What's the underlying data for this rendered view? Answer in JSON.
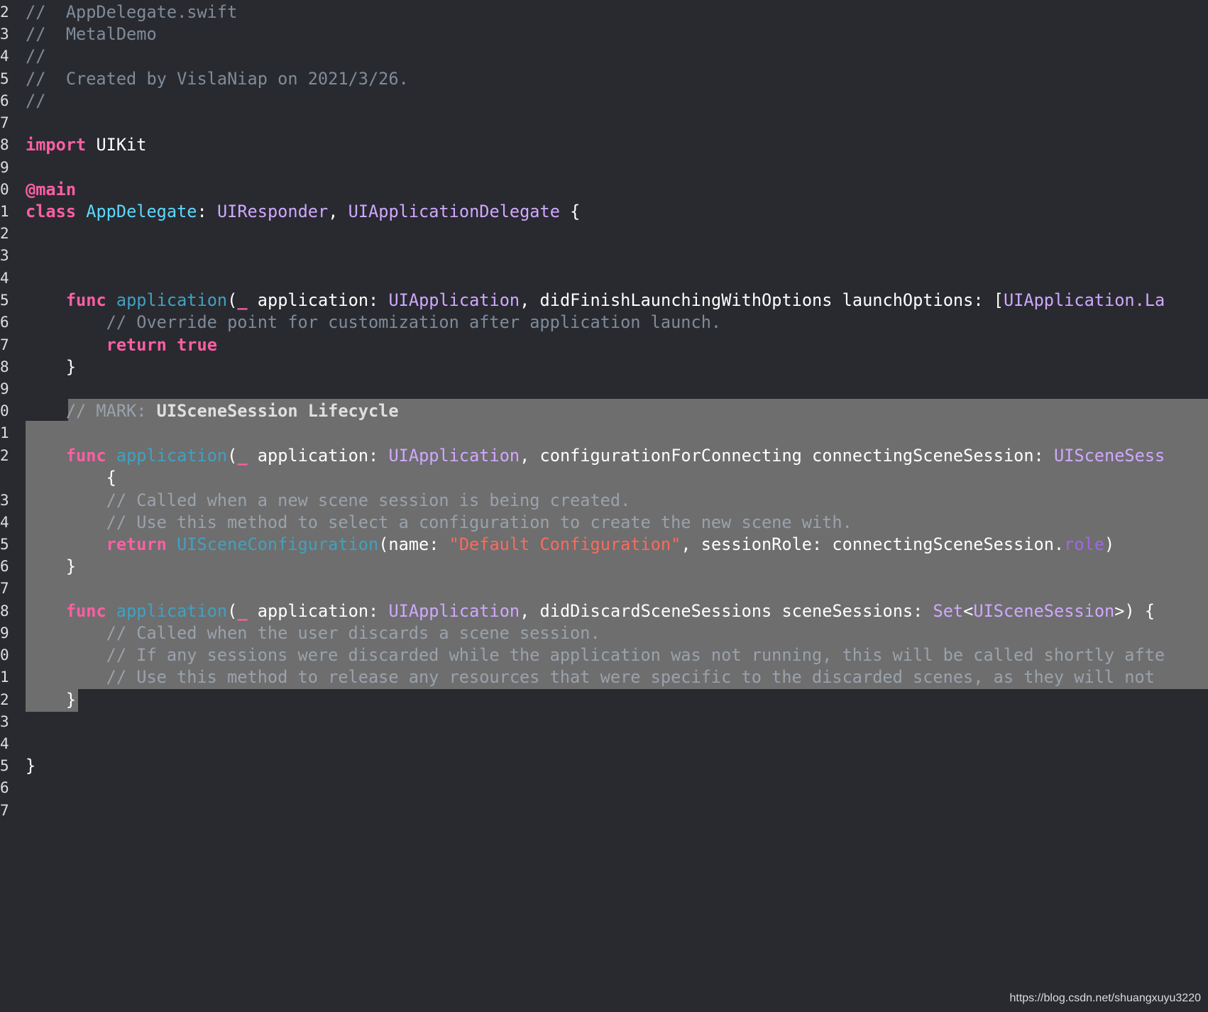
{
  "editor": {
    "file_name": "AppDelegate.swift",
    "lines": [
      {
        "num": "2",
        "tokens": [
          {
            "t": "//  AppDelegate.swift",
            "c": "comment"
          }
        ]
      },
      {
        "num": "3",
        "tokens": [
          {
            "t": "//  MetalDemo",
            "c": "comment"
          }
        ]
      },
      {
        "num": "4",
        "tokens": [
          {
            "t": "//",
            "c": "comment"
          }
        ]
      },
      {
        "num": "5",
        "tokens": [
          {
            "t": "//  Created by VislaNiap on 2021/3/26.",
            "c": "comment"
          }
        ]
      },
      {
        "num": "6",
        "tokens": [
          {
            "t": "//",
            "c": "comment"
          }
        ]
      },
      {
        "num": "7",
        "tokens": []
      },
      {
        "num": "8",
        "tokens": [
          {
            "t": "import",
            "c": "keyword"
          },
          {
            "t": " UIKit",
            "c": "plain"
          }
        ]
      },
      {
        "num": "9",
        "tokens": []
      },
      {
        "num": "0",
        "tokens": [
          {
            "t": "@main",
            "c": "keyword"
          }
        ]
      },
      {
        "num": "1",
        "tokens": [
          {
            "t": "class",
            "c": "keyword"
          },
          {
            "t": " ",
            "c": "plain"
          },
          {
            "t": "AppDelegate",
            "c": "decl"
          },
          {
            "t": ": ",
            "c": "plain"
          },
          {
            "t": "UIResponder",
            "c": "type"
          },
          {
            "t": ", ",
            "c": "plain"
          },
          {
            "t": "UIApplicationDelegate",
            "c": "type"
          },
          {
            "t": " {",
            "c": "plain"
          }
        ]
      },
      {
        "num": "2",
        "tokens": []
      },
      {
        "num": "3",
        "tokens": []
      },
      {
        "num": "4",
        "tokens": []
      },
      {
        "num": "5",
        "tokens": [
          {
            "t": "    ",
            "c": "plain"
          },
          {
            "t": "func",
            "c": "keyword"
          },
          {
            "t": " ",
            "c": "plain"
          },
          {
            "t": "application",
            "c": "func"
          },
          {
            "t": "(",
            "c": "plain"
          },
          {
            "t": "_",
            "c": "keyword"
          },
          {
            "t": " application: ",
            "c": "plain"
          },
          {
            "t": "UIApplication",
            "c": "type"
          },
          {
            "t": ", didFinishLaunchingWithOptions launchOptions: [",
            "c": "plain"
          },
          {
            "t": "UIApplication.La",
            "c": "type"
          }
        ]
      },
      {
        "num": "6",
        "tokens": [
          {
            "t": "        // Override point for customization after application launch.",
            "c": "comment"
          }
        ]
      },
      {
        "num": "7",
        "tokens": [
          {
            "t": "        ",
            "c": "plain"
          },
          {
            "t": "return",
            "c": "keyword"
          },
          {
            "t": " ",
            "c": "plain"
          },
          {
            "t": "true",
            "c": "keyword"
          }
        ]
      },
      {
        "num": "8",
        "tokens": [
          {
            "t": "    }",
            "c": "plain"
          }
        ]
      },
      {
        "num": "9",
        "tokens": []
      },
      {
        "num": "0",
        "tokens": [
          {
            "t": "    // MARK: ",
            "c": "comment"
          },
          {
            "t": "UISceneSession Lifecycle",
            "c": "markbold"
          }
        ]
      },
      {
        "num": "1",
        "tokens": []
      },
      {
        "num": "2",
        "tokens": [
          {
            "t": "    ",
            "c": "plain"
          },
          {
            "t": "func",
            "c": "keyword"
          },
          {
            "t": " ",
            "c": "plain"
          },
          {
            "t": "application",
            "c": "func"
          },
          {
            "t": "(",
            "c": "plain"
          },
          {
            "t": "_",
            "c": "keyword"
          },
          {
            "t": " application: ",
            "c": "plain"
          },
          {
            "t": "UIApplication",
            "c": "type"
          },
          {
            "t": ", configurationForConnecting connectingSceneSession: ",
            "c": "plain"
          },
          {
            "t": "UISceneSess",
            "c": "type"
          }
        ]
      },
      {
        "num": "",
        "tokens": [
          {
            "t": "        {",
            "c": "plain"
          }
        ]
      },
      {
        "num": "3",
        "tokens": [
          {
            "t": "        // Called when a new scene session is being created.",
            "c": "comment"
          }
        ]
      },
      {
        "num": "4",
        "tokens": [
          {
            "t": "        // Use this method to select a configuration to create the new scene with.",
            "c": "comment"
          }
        ]
      },
      {
        "num": "5",
        "tokens": [
          {
            "t": "        ",
            "c": "plain"
          },
          {
            "t": "return",
            "c": "keyword"
          },
          {
            "t": " ",
            "c": "plain"
          },
          {
            "t": "UISceneConfiguration",
            "c": "func"
          },
          {
            "t": "(name: ",
            "c": "plain"
          },
          {
            "t": "\"Default Configuration\"",
            "c": "string"
          },
          {
            "t": ", sessionRole: connectingSceneSession.",
            "c": "plain"
          },
          {
            "t": "role",
            "c": "member"
          },
          {
            "t": ")",
            "c": "plain"
          }
        ]
      },
      {
        "num": "6",
        "tokens": [
          {
            "t": "    }",
            "c": "plain"
          }
        ]
      },
      {
        "num": "7",
        "tokens": []
      },
      {
        "num": "8",
        "tokens": [
          {
            "t": "    ",
            "c": "plain"
          },
          {
            "t": "func",
            "c": "keyword"
          },
          {
            "t": " ",
            "c": "plain"
          },
          {
            "t": "application",
            "c": "func"
          },
          {
            "t": "(",
            "c": "plain"
          },
          {
            "t": "_",
            "c": "keyword"
          },
          {
            "t": " application: ",
            "c": "plain"
          },
          {
            "t": "UIApplication",
            "c": "type"
          },
          {
            "t": ", didDiscardSceneSessions sceneSessions: ",
            "c": "plain"
          },
          {
            "t": "Set",
            "c": "type"
          },
          {
            "t": "<",
            "c": "plain"
          },
          {
            "t": "UISceneSession",
            "c": "type"
          },
          {
            "t": ">) {",
            "c": "plain"
          }
        ]
      },
      {
        "num": "9",
        "tokens": [
          {
            "t": "        // Called when the user discards a scene session.",
            "c": "comment"
          }
        ]
      },
      {
        "num": "0",
        "tokens": [
          {
            "t": "        // If any sessions were discarded while the application was not running, this will be called shortly afte",
            "c": "comment"
          }
        ]
      },
      {
        "num": "1",
        "tokens": [
          {
            "t": "        // Use this method to release any resources that were specific to the discarded scenes, as they will not",
            "c": "comment"
          }
        ]
      },
      {
        "num": "2",
        "tokens": [
          {
            "t": "    }",
            "c": "plain"
          }
        ]
      },
      {
        "num": "3",
        "tokens": []
      },
      {
        "num": "4",
        "tokens": []
      },
      {
        "num": "5",
        "tokens": [
          {
            "t": "}",
            "c": "plain"
          }
        ]
      },
      {
        "num": "6",
        "tokens": []
      },
      {
        "num": "7",
        "tokens": []
      }
    ]
  },
  "watermark": "https://blog.csdn.net/shuangxuyu3220",
  "colors": {
    "background": "#292a30",
    "selection": "#6e6e6e",
    "keyword": "#fc5fa3",
    "type": "#d0a8ff",
    "string": "#fc6a5d",
    "comment": "#7f8c98"
  }
}
